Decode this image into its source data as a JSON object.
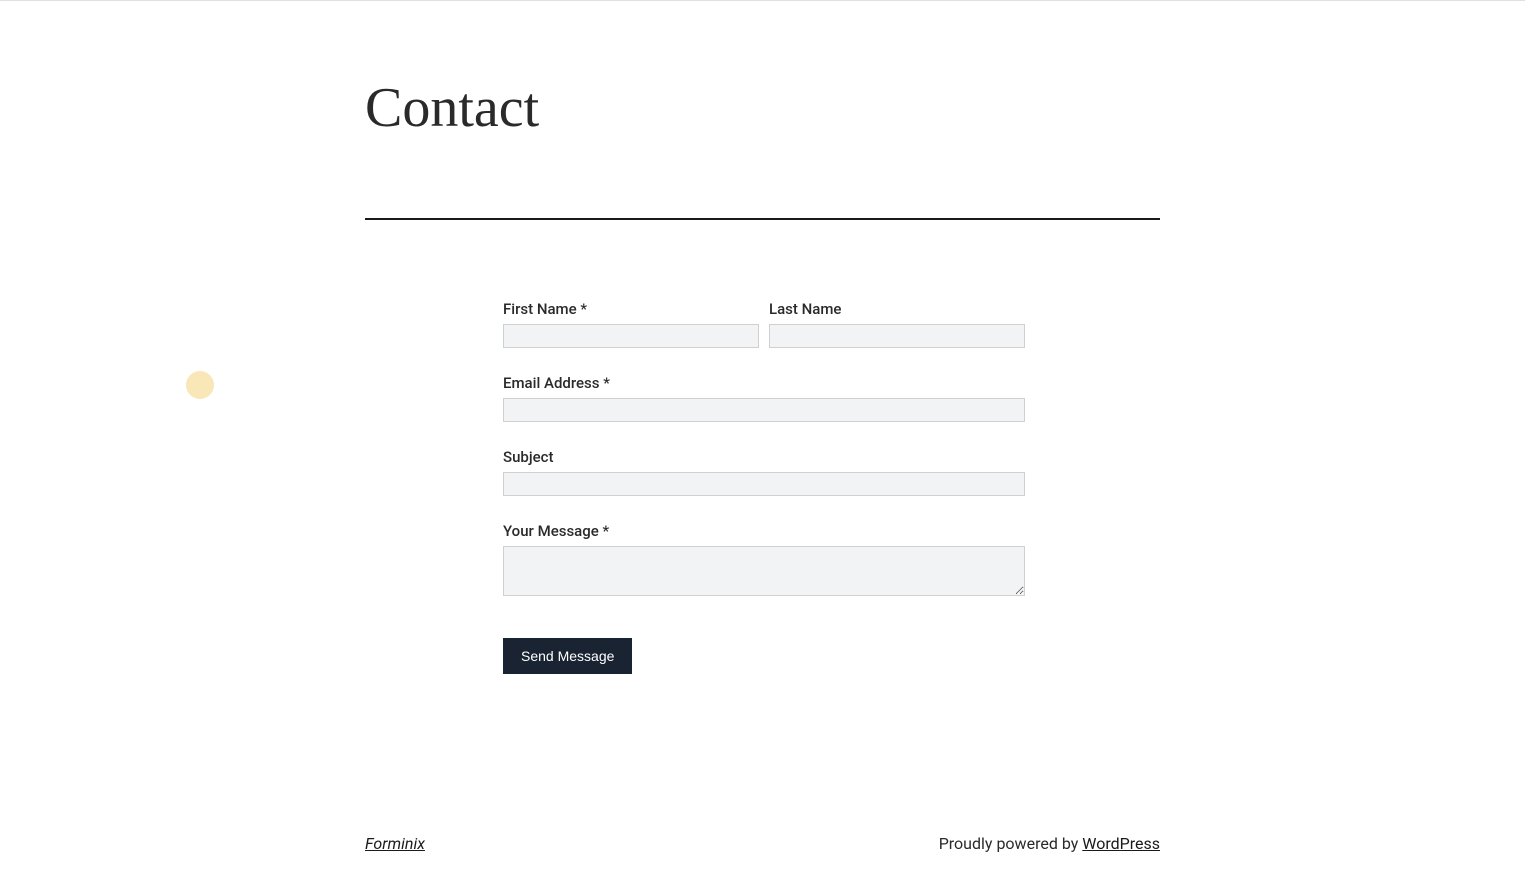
{
  "page": {
    "title": "Contact"
  },
  "form": {
    "first_name_label": "First Name *",
    "last_name_label": "Last Name",
    "email_label": "Email Address *",
    "subject_label": "Subject",
    "message_label": "Your Message *",
    "submit_label": "Send Message"
  },
  "footer": {
    "brand": "Forminix",
    "powered_by_prefix": "Proudly powered by ",
    "powered_by_link": "WordPress"
  }
}
